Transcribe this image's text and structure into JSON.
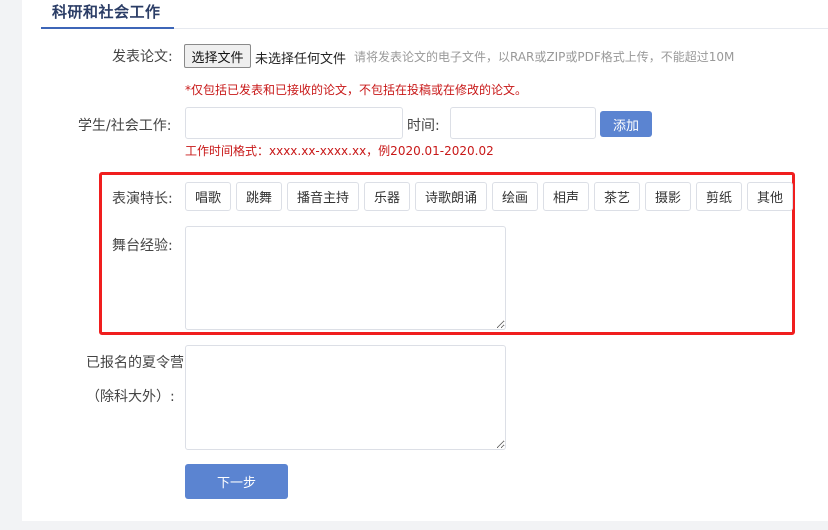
{
  "section": {
    "title": "科研和社会工作"
  },
  "paper": {
    "label": "发表论文:",
    "file_button": "选择文件",
    "file_status": "未选择任何文件",
    "hint": "请将发表论文的电子文件，以RAR或ZIP或PDF格式上传，不能超过10M",
    "note": "*仅包括已发表和已接收的论文，不包括在投稿或在修改的论文。"
  },
  "work": {
    "label": "学生/社会工作:",
    "work_value": "",
    "time_label": "时间:",
    "time_value": "",
    "add_button": "添加",
    "format_note": "工作时间格式：xxxx.xx-xxxx.xx，例2020.01-2020.02"
  },
  "talent": {
    "label": "表演特长:",
    "tags": [
      "唱歌",
      "跳舞",
      "播音主持",
      "乐器",
      "诗歌朗诵",
      "绘画",
      "相声",
      "茶艺",
      "摄影",
      "剪纸",
      "其他"
    ]
  },
  "stage": {
    "label": "舞台经验:",
    "value": ""
  },
  "camp": {
    "label_line1": "已报名的夏令营",
    "label_line2": "（除科大外）:",
    "value": ""
  },
  "next_button": "下一步",
  "colors": {
    "primary": "#5b84d1",
    "highlight_border": "#f01e1e",
    "warning_text": "#c81818"
  }
}
